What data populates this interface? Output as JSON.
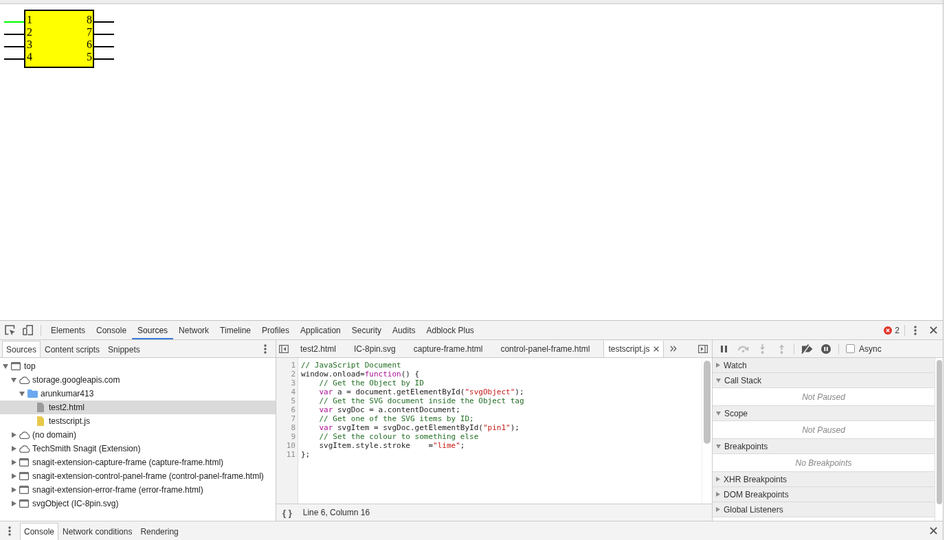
{
  "page": {
    "chip": {
      "left_pins": [
        {
          "label": "1",
          "color": "#00ff00"
        },
        {
          "label": "2",
          "color": "#000000"
        },
        {
          "label": "3",
          "color": "#000000"
        },
        {
          "label": "4",
          "color": "#000000"
        }
      ],
      "right_pins": [
        {
          "label": "8",
          "color": "#000000"
        },
        {
          "label": "7",
          "color": "#000000"
        },
        {
          "label": "6",
          "color": "#000000"
        },
        {
          "label": "5",
          "color": "#000000"
        }
      ]
    }
  },
  "devtools": {
    "toolbar": {
      "tabs": [
        {
          "label": "Elements",
          "selected": false
        },
        {
          "label": "Console",
          "selected": false
        },
        {
          "label": "Sources",
          "selected": true
        },
        {
          "label": "Network",
          "selected": false
        },
        {
          "label": "Timeline",
          "selected": false
        },
        {
          "label": "Profiles",
          "selected": false
        },
        {
          "label": "Application",
          "selected": false
        },
        {
          "label": "Security",
          "selected": false
        },
        {
          "label": "Audits",
          "selected": false
        },
        {
          "label": "Adblock Plus",
          "selected": false
        }
      ],
      "error_count": "2"
    },
    "navigator": {
      "tabs": [
        {
          "label": "Sources",
          "selected": true
        },
        {
          "label": "Content scripts",
          "selected": false
        },
        {
          "label": "Snippets",
          "selected": false
        }
      ],
      "tree": [
        {
          "kind": "frame",
          "label": "top",
          "expanded": true,
          "selected": false,
          "children": [
            {
              "kind": "domain",
              "label": "storage.googleapis.com",
              "expanded": true,
              "selected": false,
              "children": [
                {
                  "kind": "folder",
                  "label": "arunkumar413",
                  "expanded": true,
                  "selected": false,
                  "children": [
                    {
                      "kind": "file",
                      "label": "test2.html",
                      "selected": true,
                      "color": "#9b9b9b"
                    },
                    {
                      "kind": "file",
                      "label": "testscript.js",
                      "selected": false,
                      "color": "#e8c84a"
                    }
                  ]
                }
              ]
            },
            {
              "kind": "domain",
              "label": "(no domain)",
              "expanded": false,
              "selected": false
            },
            {
              "kind": "domain",
              "label": "TechSmith Snagit (Extension)",
              "expanded": false,
              "selected": false
            },
            {
              "kind": "frame",
              "label": "snagit-extension-capture-frame (capture-frame.html)",
              "expanded": false,
              "selected": false
            },
            {
              "kind": "frame",
              "label": "snagit-extension-control-panel-frame (control-panel-frame.html)",
              "expanded": false,
              "selected": false
            },
            {
              "kind": "frame",
              "label": "snagit-extension-error-frame (error-frame.html)",
              "expanded": false,
              "selected": false
            },
            {
              "kind": "frame",
              "label": "svgObject (IC-8pin.svg)",
              "expanded": false,
              "selected": false
            }
          ]
        }
      ]
    },
    "editor": {
      "tabs": [
        {
          "label": "test2.html",
          "selected": false
        },
        {
          "label": "IC-8pin.svg",
          "selected": false
        },
        {
          "label": "capture-frame.html",
          "selected": false
        },
        {
          "label": "control-panel-frame.html",
          "selected": false
        },
        {
          "label": "testscript.js",
          "selected": true
        }
      ],
      "lines": [
        {
          "number": "1",
          "tokens": [
            {
              "kind": "comment",
              "text": "// JavaScript Document"
            }
          ]
        },
        {
          "number": "2",
          "tokens": [
            {
              "kind": "plain",
              "text": "window.onload="
            },
            {
              "kind": "keyword",
              "text": "function"
            },
            {
              "kind": "plain",
              "text": "() {"
            }
          ]
        },
        {
          "number": "3",
          "tokens": [
            {
              "kind": "comment",
              "text": "    // Get the Object by ID"
            }
          ]
        },
        {
          "number": "4",
          "tokens": [
            {
              "kind": "keyword",
              "text": "    var"
            },
            {
              "kind": "plain",
              "text": " a = document.getElementById("
            },
            {
              "kind": "string",
              "text": "\"svgObject\""
            },
            {
              "kind": "plain",
              "text": ");"
            }
          ]
        },
        {
          "number": "5",
          "tokens": [
            {
              "kind": "comment",
              "text": "    // Get the SVG document inside the Object tag"
            }
          ]
        },
        {
          "number": "6",
          "tokens": [
            {
              "kind": "keyword",
              "text": "    var"
            },
            {
              "kind": "plain",
              "text": " svgDoc = a.contentDocument;"
            }
          ]
        },
        {
          "number": "7",
          "tokens": [
            {
              "kind": "comment",
              "text": "    // Get one of the SVG items by ID;"
            }
          ]
        },
        {
          "number": "8",
          "tokens": [
            {
              "kind": "keyword",
              "text": "    var"
            },
            {
              "kind": "plain",
              "text": " svgItem = svgDoc.getElementById("
            },
            {
              "kind": "string",
              "text": "\"pin1\""
            },
            {
              "kind": "plain",
              "text": ");"
            }
          ]
        },
        {
          "number": "9",
          "tokens": [
            {
              "kind": "comment",
              "text": "    // Set the colour to something else"
            }
          ]
        },
        {
          "number": "10",
          "tokens": [
            {
              "kind": "plain",
              "text": "    svgItem.style.stroke    ="
            },
            {
              "kind": "string",
              "text": "\"lime\""
            },
            {
              "kind": "plain",
              "text": ";"
            }
          ]
        },
        {
          "number": "11",
          "tokens": [
            {
              "kind": "plain",
              "text": "};"
            }
          ]
        }
      ],
      "format_button": "{ }",
      "cursor_position": "Line 6, Column 16"
    },
    "debugger": {
      "stepping": [
        {
          "kind": "pause",
          "disabled": false
        },
        {
          "kind": "step-over",
          "disabled": true
        },
        {
          "kind": "step-into",
          "disabled": true
        },
        {
          "kind": "step-out",
          "disabled": true
        }
      ],
      "breakpoint_controls": [
        {
          "kind": "deactivate-breakpoints",
          "disabled": false
        },
        {
          "kind": "pause-on-exceptions",
          "disabled": false
        }
      ],
      "async": {
        "label": "Async",
        "checked": false
      },
      "sections": [
        {
          "title": "Watch",
          "expanded": false
        },
        {
          "title": "Call Stack",
          "expanded": true,
          "message": "Not Paused"
        },
        {
          "title": "Scope",
          "expanded": true,
          "message": "Not Paused"
        },
        {
          "title": "Breakpoints",
          "expanded": true,
          "message": "No Breakpoints"
        },
        {
          "title": "XHR Breakpoints",
          "expanded": false
        },
        {
          "title": "DOM Breakpoints",
          "expanded": false
        },
        {
          "title": "Global Listeners",
          "expanded": false
        }
      ]
    },
    "drawer": {
      "tabs": [
        {
          "label": "Console",
          "selected": true
        },
        {
          "label": "Network conditions",
          "selected": false
        },
        {
          "label": "Rendering",
          "selected": false
        }
      ]
    }
  }
}
